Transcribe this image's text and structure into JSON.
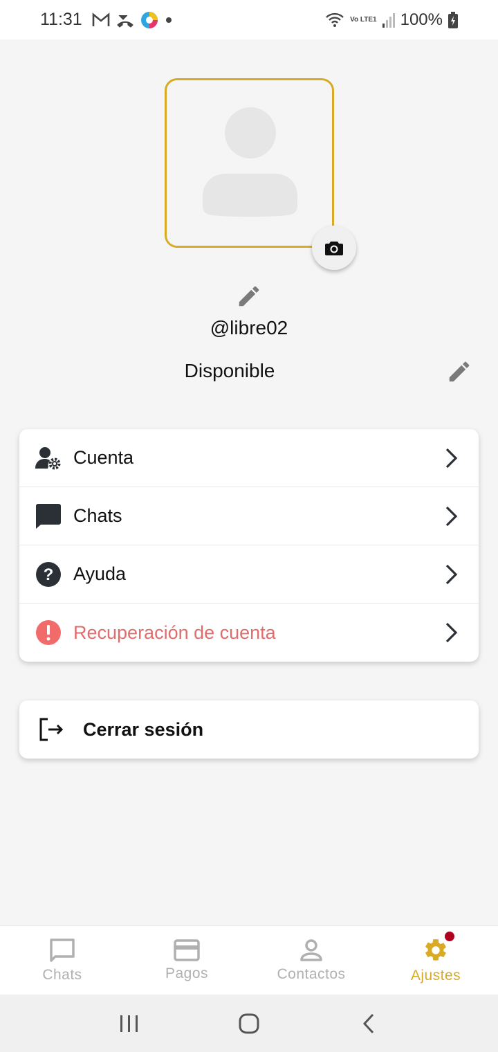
{
  "status_bar": {
    "time": "11:31",
    "battery": "100%",
    "network_label": "Vo LTE1"
  },
  "profile": {
    "username": "@libre02",
    "status": "Disponible"
  },
  "menu": {
    "items": [
      {
        "label": "Cuenta",
        "icon": "account-settings-icon"
      },
      {
        "label": "Chats",
        "icon": "chat-icon"
      },
      {
        "label": "Ayuda",
        "icon": "help-icon"
      },
      {
        "label": "Recuperación de cuenta",
        "icon": "alert-icon",
        "color": "#e06d6d"
      }
    ]
  },
  "logout": {
    "label": "Cerrar sesión",
    "icon": "logout-icon"
  },
  "bottom_nav": {
    "items": [
      {
        "label": "Chats",
        "icon": "chat-outline-icon"
      },
      {
        "label": "Pagos",
        "icon": "card-icon"
      },
      {
        "label": "Contactos",
        "icon": "person-icon"
      },
      {
        "label": "Ajustes",
        "icon": "gear-icon",
        "active": true
      }
    ]
  },
  "colors": {
    "accent": "#d9ab24",
    "danger": "#e06d6d",
    "badge": "#b00020"
  }
}
